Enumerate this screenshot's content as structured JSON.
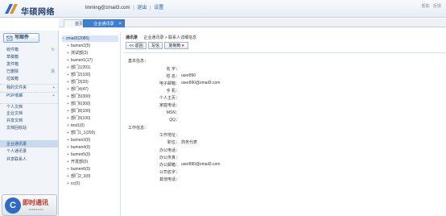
{
  "header": {
    "brand": "华硕网络",
    "user_email": "linming@zmail3.com",
    "logout": "退出",
    "settings": "设置",
    "right_links": [
      "帮助",
      "反馈"
    ]
  },
  "tabs": [
    {
      "label": "首页"
    },
    {
      "label": "企业通讯录",
      "active": true
    }
  ],
  "sidebar": {
    "write": "写邮件",
    "items": [
      {
        "label": "收件箱",
        "badge": ""
      },
      {
        "label": "草稿箱",
        "badge": ""
      },
      {
        "label": "发件箱",
        "badge": ""
      },
      {
        "label": "已删除",
        "badge": "清"
      },
      {
        "label": "垃圾箱",
        "badge": ""
      },
      {
        "label": "我的文件夹",
        "badge": "+"
      },
      {
        "label": "POP收邮",
        "badge": "+"
      },
      {
        "label": "个人文档",
        "badge": ""
      },
      {
        "label": "企业文档",
        "badge": ""
      },
      {
        "label": "共享文档",
        "badge": ""
      },
      {
        "label": "文档回收站",
        "badge": ""
      },
      {
        "label": "企业通讯录",
        "badge": ""
      },
      {
        "label": "个人通讯录",
        "badge": ""
      },
      {
        "label": "共享联系人",
        "badge": ""
      }
    ],
    "chat": {
      "title": "即时通讯",
      "sub": "DOWNLOAD"
    }
  },
  "tree": {
    "root": "zmail3(2085)",
    "nodes": [
      "bumen2(5)",
      "测试部(3)",
      "bumen1(17)",
      "部门1(201)",
      "部门2(100)",
      "部门3(33)",
      "部门4(47)",
      "部门5(300)",
      "部门6(300)",
      "部门8(100)",
      "部门9(100)",
      "test1(0)",
      "部门1_1(200)",
      "bumen3(0)",
      "bumen4(0)",
      "bumen5(0)",
      "开发部(0)",
      "bumen6(0)",
      "部门2_3(0)",
      "cc(0)"
    ]
  },
  "main": {
    "crumb_title": "通讯录",
    "crumb_path": "企业通讯录 > 联系人详细信息",
    "toolbar": {
      "back": "<< 返回",
      "edit": "写信",
      "copy": "复制到"
    },
    "basic_header": "基本信息：",
    "basic": [
      {
        "label": "名 字：",
        "value": ""
      },
      {
        "label": "姓 名：",
        "value": "user890"
      },
      {
        "label": "电子邮箱：",
        "value": "user890@zmail3.com"
      },
      {
        "label": "手 机：",
        "value": ""
      },
      {
        "label": "个人主页：",
        "value": ""
      },
      {
        "label": "家庭电话：",
        "value": ""
      },
      {
        "label": "MSN：",
        "value": ""
      },
      {
        "label": "QQ：",
        "value": ""
      }
    ],
    "work_header": "工作信息：",
    "work": [
      {
        "label": "工作地址：",
        "value": ""
      },
      {
        "label": "职位：",
        "value": "商务代表"
      },
      {
        "label": "办公电话：",
        "value": ""
      },
      {
        "label": "办公传真：",
        "value": ""
      },
      {
        "label": "办公邮箱：",
        "value": "user890@zmail3.com"
      },
      {
        "label": "公司名字：",
        "value": ""
      },
      {
        "label": "其他电话：",
        "value": ""
      }
    ]
  },
  "colors": {
    "accent": "#3f7fd1",
    "brand": "#1e3c6e",
    "chat_red": "#c03021"
  }
}
